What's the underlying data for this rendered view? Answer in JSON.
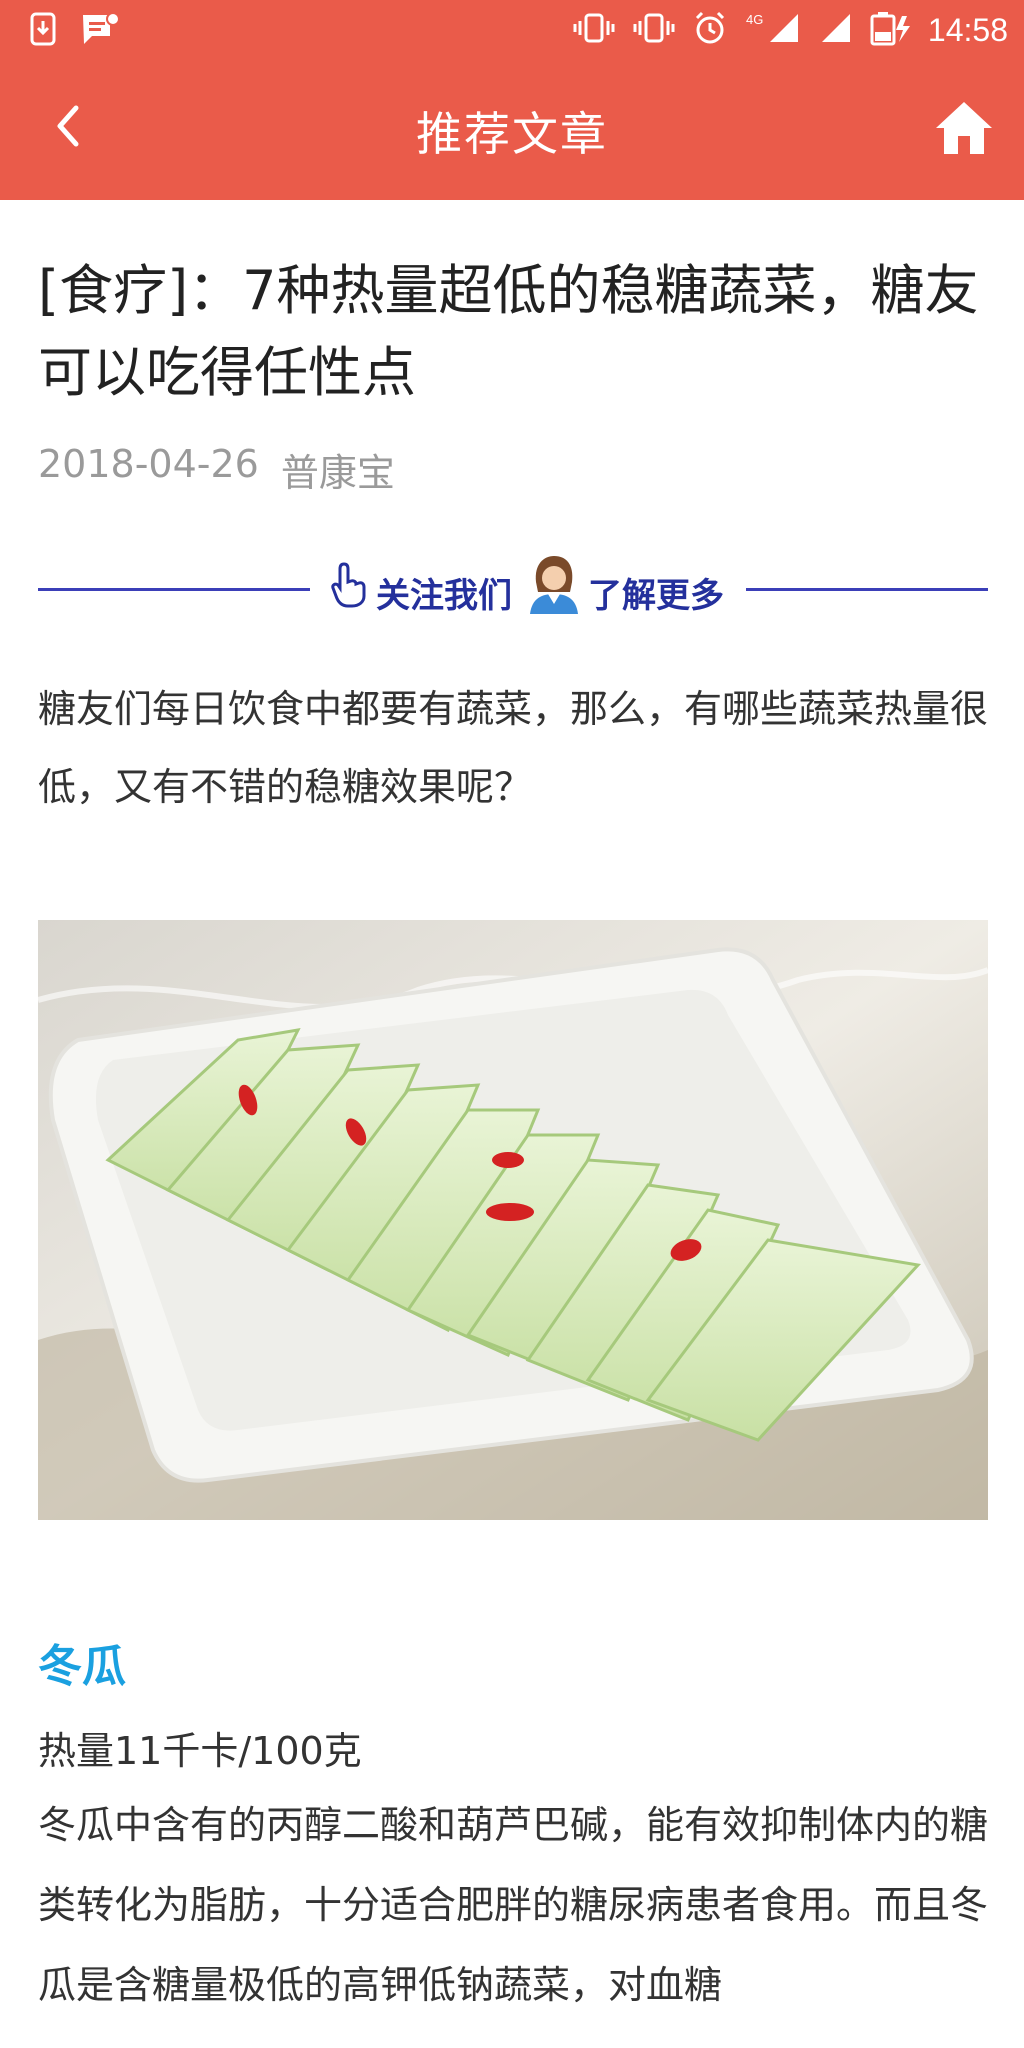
{
  "status_bar": {
    "time": "14:58",
    "network": "4G"
  },
  "toolbar": {
    "title": "推荐文章",
    "back_icon": "chevron-left-icon",
    "home_icon": "home-icon"
  },
  "article": {
    "title": "[食疗]：7种热量超低的稳糖蔬菜，糖友可以吃得任性点",
    "date": "2018-04-26",
    "source": "普康宝",
    "follow_banner": {
      "left_text": "关注我们",
      "right_text": "了解更多"
    },
    "intro": "糖友们每日饮食中都要有蔬菜，那么，有哪些蔬菜热量很低，又有不错的稳糖效果呢？",
    "section": {
      "title": "冬瓜",
      "calories": "热量11千卡/100克",
      "body": "冬瓜中含有的丙醇二酸和葫芦巴碱，能有效抑制体内的糖类转化为脂肪，十分适合肥胖的糖尿病患者食用。而且冬瓜是含糖量极低的高钾低钠蔬菜，对血糖"
    }
  },
  "colors": {
    "header": "#ea5b4a",
    "section_title": "#1aa0e0",
    "banner_line": "#3b3fb8"
  }
}
